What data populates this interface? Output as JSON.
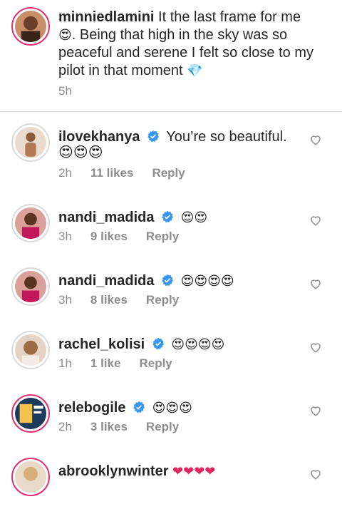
{
  "post": {
    "username": "minniedlamini",
    "caption_part1": " It the last frame for me ",
    "emoji1": "😍",
    "caption_part2": ". Being that high in the sky was so peaceful and serene I felt so close to my pilot in that moment ",
    "emoji2": "💎",
    "time": "5h"
  },
  "comments": [
    {
      "username": "ilovekhanya",
      "text": " You’re so beautiful.",
      "emojis": "😍😍😍",
      "time": "2h",
      "likes": "11 likes",
      "reply": "Reply"
    },
    {
      "username": "nandi_madida",
      "text": "",
      "emojis": "😍😍",
      "time": "3h",
      "likes": "9 likes",
      "reply": "Reply"
    },
    {
      "username": "nandi_madida",
      "text": "",
      "emojis": "😍😍😍😍",
      "time": "3h",
      "likes": "8 likes",
      "reply": "Reply"
    },
    {
      "username": "rachel_kolisi",
      "text": "",
      "emojis": "😍😍😍😍",
      "time": "1h",
      "likes": "1 like",
      "reply": "Reply"
    },
    {
      "username": "relebogile",
      "text": "",
      "emojis": "😍😍😍",
      "time": "2h",
      "likes": "3 likes",
      "reply": "Reply"
    },
    {
      "username": "abrooklynwinter",
      "text": "",
      "emojis": "❤❤❤❤",
      "time": "",
      "likes": "",
      "reply": ""
    }
  ],
  "colors": {
    "accent": "#e1306c",
    "verified": "#3897f0",
    "muted": "#8e8e8e"
  }
}
